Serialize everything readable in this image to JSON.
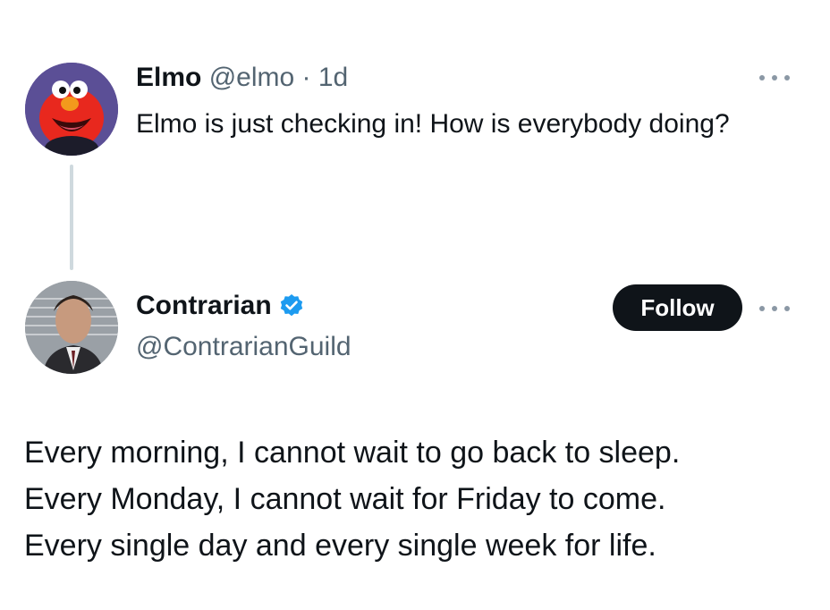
{
  "tweet1": {
    "name": "Elmo",
    "handle": "@elmo",
    "separator": "·",
    "time": "1d",
    "text": "Elmo is just checking in! How is everybody doing?"
  },
  "tweet2": {
    "name": "Contrarian",
    "handle": "@ContrarianGuild",
    "follow_label": "Follow",
    "body_lines": [
      "Every morning, I cannot wait to go back to sleep.",
      "Every Monday, I cannot wait for Friday to come.",
      "Every single day and every single week for life."
    ]
  },
  "colors": {
    "verified_blue": "#1d9bf0",
    "follow_bg": "#0f1419",
    "muted_text": "#536471",
    "thread_line": "#cfd9de"
  },
  "icons": {
    "verified": "verified-badge-icon",
    "more": "more-options-icon"
  }
}
